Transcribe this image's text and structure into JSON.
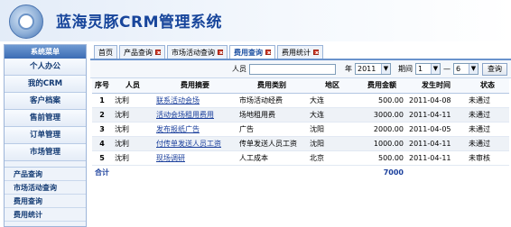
{
  "app": {
    "title": "蓝海灵豚CRM管理系统"
  },
  "sidebar": {
    "header": "系统菜单",
    "items": [
      {
        "label": "个人办公"
      },
      {
        "label": "我的CRM"
      },
      {
        "label": "客户档案"
      },
      {
        "label": "售前管理"
      },
      {
        "label": "订单管理"
      },
      {
        "label": "市场管理"
      }
    ],
    "sub_items": [
      {
        "label": "产品查询"
      },
      {
        "label": "市场活动查询"
      },
      {
        "label": "费用查询"
      },
      {
        "label": "费用统计"
      }
    ]
  },
  "tabs": [
    {
      "label": "首页",
      "closable": false
    },
    {
      "label": "产品查询",
      "closable": true
    },
    {
      "label": "市场活动查询",
      "closable": true
    },
    {
      "label": "费用查询",
      "closable": true,
      "active": true
    },
    {
      "label": "费用统计",
      "closable": true
    }
  ],
  "filter": {
    "person_label": "人员",
    "person_value": "",
    "year_label": "年",
    "year_value": "2011",
    "period_label": "期间",
    "period_from": "1",
    "period_sep": "—",
    "period_to": "6",
    "search_label": "查询"
  },
  "table": {
    "headers": [
      "序号",
      "人员",
      "费用摘要",
      "费用类别",
      "地区",
      "费用金额",
      "发生时间",
      "状态"
    ],
    "rows": [
      {
        "no": "1",
        "person": "沈利",
        "summary": "联系活动会场",
        "category": "市场活动经费",
        "region": "大连",
        "amount": "500.00",
        "date": "2011-04-08",
        "status": "未通过"
      },
      {
        "no": "2",
        "person": "沈利",
        "summary": "活动会场租用费用",
        "category": "场地租用费",
        "region": "大连",
        "amount": "3000.00",
        "date": "2011-04-11",
        "status": "未通过"
      },
      {
        "no": "3",
        "person": "沈利",
        "summary": "发布报纸广告",
        "category": "广告",
        "region": "沈阳",
        "amount": "2000.00",
        "date": "2011-04-05",
        "status": "未通过"
      },
      {
        "no": "4",
        "person": "沈利",
        "summary": "付传单发送人员工资",
        "category": "传单发送人员工资",
        "region": "沈阳",
        "amount": "1000.00",
        "date": "2011-04-11",
        "status": "未通过"
      },
      {
        "no": "5",
        "person": "沈利",
        "summary": "现场调研",
        "category": "人工成本",
        "region": "北京",
        "amount": "500.00",
        "date": "2011-04-11",
        "status": "未审核"
      }
    ],
    "total_label": "合计",
    "total_amount": "7000"
  }
}
